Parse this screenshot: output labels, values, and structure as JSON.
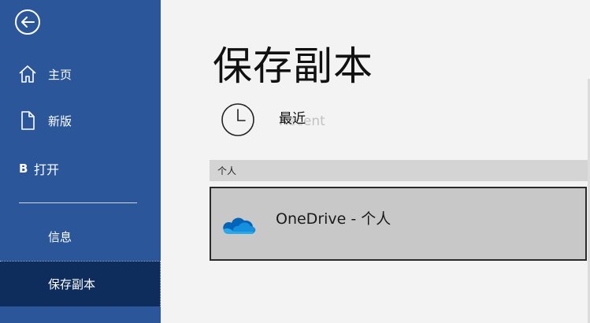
{
  "sidebar": {
    "back_icon": "back-arrow-icon",
    "items": [
      {
        "id": "home",
        "label": "主页",
        "icon": "home-icon"
      },
      {
        "id": "new",
        "label": "新版",
        "icon": "new-document-icon"
      },
      {
        "id": "open",
        "prefix": "B",
        "label": "打开"
      },
      {
        "id": "info",
        "label": "信息"
      },
      {
        "id": "saveas",
        "label": "保存副本",
        "selected": true
      }
    ],
    "colors": {
      "background": "#2b579a",
      "selected": "#0f2d5c"
    }
  },
  "main": {
    "title": "保存副本",
    "recent": {
      "label": "最近",
      "overlay_text": "Recent",
      "icon": "clock-icon"
    },
    "section": {
      "label": "个人"
    },
    "locations": [
      {
        "label": "OneDrive - 个人",
        "icon": "onedrive-cloud-icon"
      }
    ]
  }
}
